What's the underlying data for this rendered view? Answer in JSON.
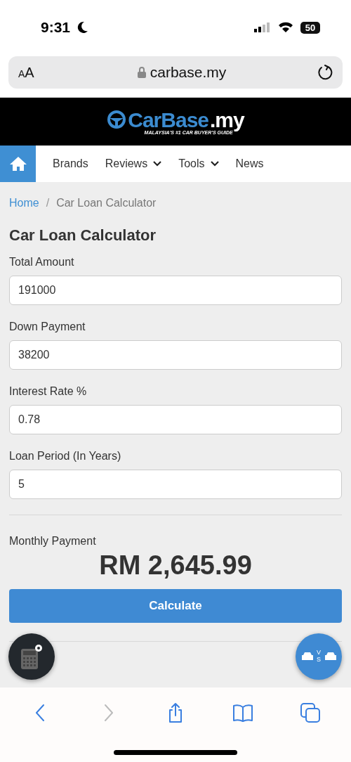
{
  "status_bar": {
    "time": "9:31",
    "battery": "50"
  },
  "browser_bar": {
    "text_size": "AA",
    "url": "carbase.my"
  },
  "logo": {
    "brand": "CarBase",
    "suffix": ".my",
    "tagline": "MALAYSIA'S #1 CAR BUYER'S GUIDE"
  },
  "nav": [
    {
      "label": "Brands",
      "kind": "link"
    },
    {
      "label": "Reviews",
      "kind": "dropdown"
    },
    {
      "label": "Tools",
      "kind": "dropdown"
    },
    {
      "label": "News",
      "kind": "link"
    }
  ],
  "breadcrumb": [
    "Home",
    "/",
    "Car Loan Calculator"
  ],
  "title": "Car Loan Calculator",
  "fields": [
    {
      "label": "Total Amount",
      "value": "191000"
    },
    {
      "label": "Down Payment",
      "value": "38200"
    },
    {
      "label": "Interest Rate %",
      "value": "0.78"
    },
    {
      "label": "Loan Period (In Years)",
      "value": "5"
    }
  ],
  "result": {
    "label": "Monthly Payment",
    "amount": "RM 2,645.99"
  },
  "calculate_button": "Calculate",
  "compare_button": {
    "label": "VS"
  },
  "toolbar": [
    {
      "kind": "back",
      "disabled": false
    },
    {
      "kind": "forward",
      "disabled": true
    },
    {
      "kind": "share",
      "disabled": false
    },
    {
      "kind": "bookmarks",
      "disabled": false
    },
    {
      "kind": "tabs",
      "disabled": false
    }
  ]
}
